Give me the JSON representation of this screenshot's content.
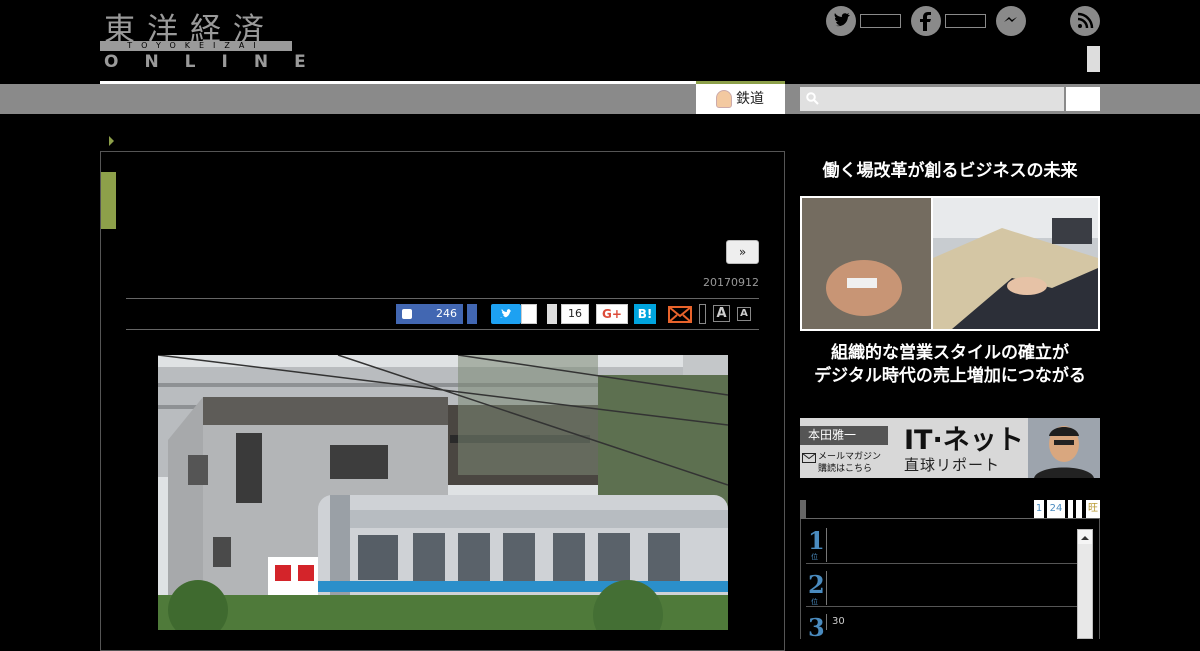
{
  "header": {
    "logo_kanji": "東洋経済",
    "logo_romaji": "TOYOKEIZAI",
    "logo_online": "ONLINE"
  },
  "nav": {
    "active_tab_label": "鉄道",
    "search_placeholder": ""
  },
  "article": {
    "next_button_label": "»",
    "date": "20170912",
    "like_count": "246",
    "share_count": "16",
    "gplus_label": "G+",
    "hatena_label": "B!",
    "font_large_label": "A",
    "font_small_label": "A"
  },
  "sidebar": {
    "ad_heading": "働く場改革が創るビジネスの未来",
    "ad_caption_line1": "組織的な営業スタイルの確立が",
    "ad_caption_line2": "デジタル時代の売上増加につながる",
    "banner": {
      "author": "本田雅一",
      "title": "IT·ネット",
      "subtitle": "直球リポート",
      "mail_line1": "メールマガジン",
      "mail_line2": "購読はこちら"
    },
    "ranking": {
      "tabs": [
        "1",
        "24",
        "",
        "",
        "旺"
      ],
      "items": [
        {
          "rank": "1",
          "unit": "位",
          "count": ""
        },
        {
          "rank": "2",
          "unit": "位",
          "count": ""
        },
        {
          "rank": "3",
          "unit": "位",
          "count": "30"
        }
      ]
    }
  },
  "colors": {
    "accent_green": "#8da04a",
    "facebook_blue": "#4267b2",
    "twitter_blue": "#1da1f2",
    "hatena_blue": "#00a4de",
    "ranking_blue": "#4a8bbf"
  },
  "icons": [
    "twitter-icon",
    "facebook-icon",
    "messenger-icon",
    "rss-icon",
    "search-icon",
    "mail-icon",
    "thumbs-up-icon"
  ]
}
